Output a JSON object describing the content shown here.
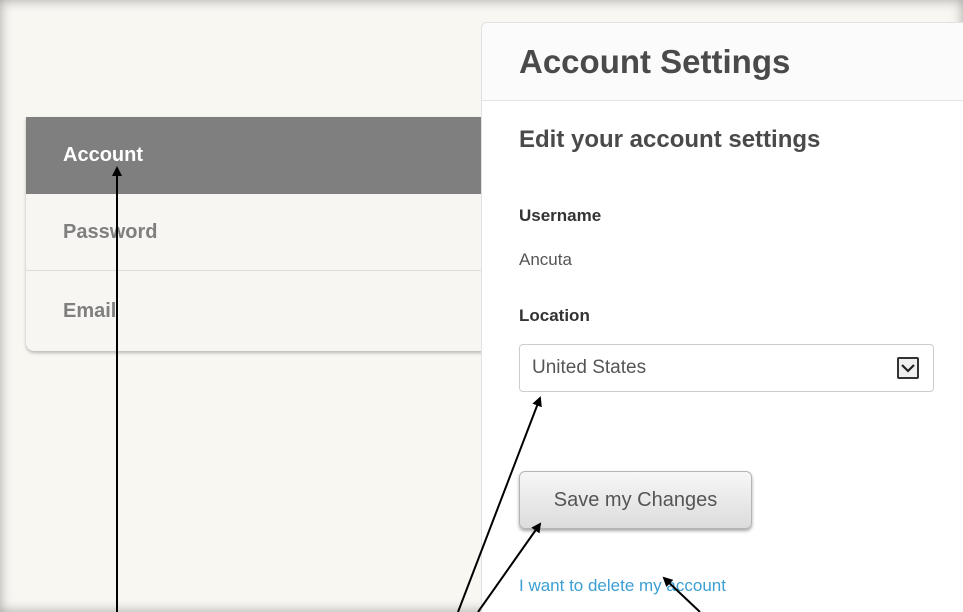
{
  "sidebar": {
    "items": [
      {
        "label": "Account",
        "active": true
      },
      {
        "label": "Password",
        "active": false
      },
      {
        "label": "Email",
        "active": false
      }
    ]
  },
  "panel": {
    "title": "Account Settings",
    "section_title": "Edit your account settings",
    "username": {
      "label": "Username",
      "value": "Ancuta"
    },
    "location": {
      "label": "Location",
      "selected": "United States"
    },
    "save_label": "Save my Changes",
    "delete_link": "I want to delete my account"
  },
  "colors": {
    "active_nav_bg": "#7f7f7f",
    "link": "#3b9fd4",
    "title_text": "#4a4a4a"
  },
  "icons": {
    "select_arrow": "chevron-down-icon"
  }
}
